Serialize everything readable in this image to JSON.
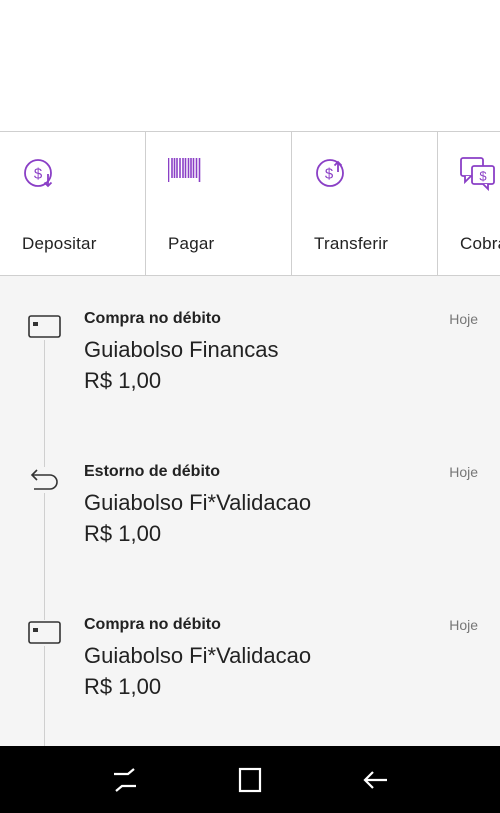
{
  "actions": [
    {
      "label": "Depositar",
      "icon": "deposit-icon"
    },
    {
      "label": "Pagar",
      "icon": "barcode-icon"
    },
    {
      "label": "Transferir",
      "icon": "transfer-icon"
    },
    {
      "label": "Cobrar",
      "icon": "charge-icon"
    }
  ],
  "transactions": [
    {
      "type": "Compra no débito",
      "description": "Guiabolso Financas",
      "amount": "R$ 1,00",
      "date": "Hoje",
      "icon": "card-icon"
    },
    {
      "type": "Estorno de débito",
      "description": "Guiabolso Fi*Validacao",
      "amount": "R$ 1,00",
      "date": "Hoje",
      "icon": "refund-icon"
    },
    {
      "type": "Compra no débito",
      "description": "Guiabolso Fi*Validacao",
      "amount": "R$ 1,00",
      "date": "Hoje",
      "icon": "card-icon"
    }
  ],
  "colors": {
    "accent": "#8a3fc6",
    "text": "#222222",
    "muted": "#777777",
    "feed_background": "#f5f5f5",
    "navbar": "#000000"
  },
  "navbar": {
    "buttons": [
      "recent-apps-icon",
      "home-icon",
      "back-icon"
    ]
  }
}
